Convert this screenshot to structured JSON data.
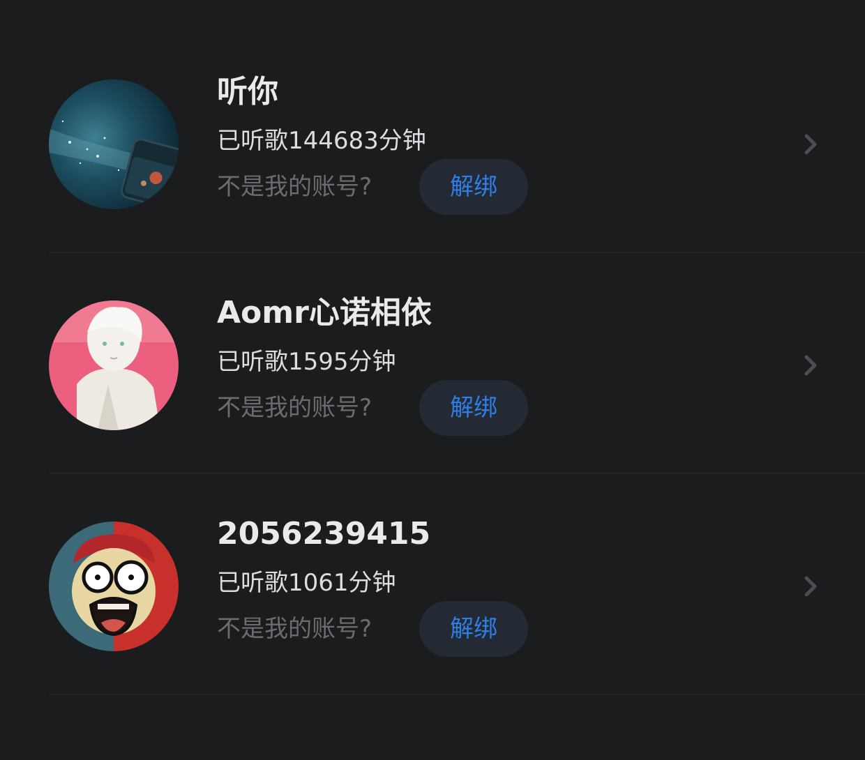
{
  "accounts": [
    {
      "name": "听你",
      "listen_time": "已听歌144683分钟",
      "not_mine_label": "不是我的账号?",
      "unbind_label": "解绑",
      "avatar_icon": "galaxy-bottle-avatar"
    },
    {
      "name": "Aomr心诺相依",
      "listen_time": "已听歌1595分钟",
      "not_mine_label": "不是我的账号?",
      "unbind_label": "解绑",
      "avatar_icon": "anime-boy-avatar"
    },
    {
      "name": "2056239415",
      "listen_time": "已听歌1061分钟",
      "not_mine_label": "不是我的账号?",
      "unbind_label": "解绑",
      "avatar_icon": "cartoon-face-avatar"
    }
  ],
  "colors": {
    "background": "#1b1c1e",
    "accent": "#2f7ee6",
    "button_bg": "#232a34",
    "muted_text": "#6a6c70",
    "divider": "#232428"
  }
}
